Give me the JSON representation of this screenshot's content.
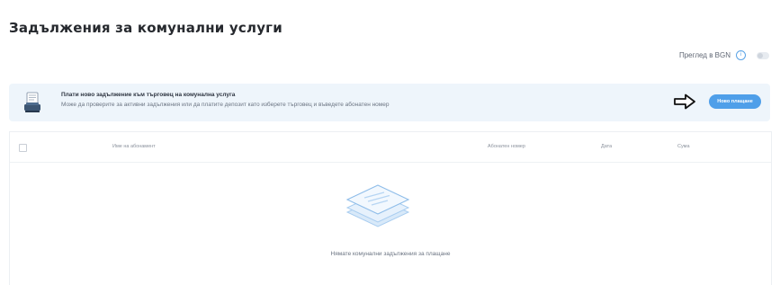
{
  "page": {
    "title": "Задължения за комунални услуги"
  },
  "currency_view": {
    "label": "Преглед в BGN",
    "info_icon": "info-icon"
  },
  "banner": {
    "icon": "document-stamp-icon",
    "title": "Плати ново задължение към търговец на комунална услуга",
    "text": "Може да проверите за активни задължения или да платите депозит като изберете търговец и въведете абонатен номер",
    "arrow_icon": "arrow-right-icon",
    "button_label": "Ново плащане"
  },
  "table": {
    "columns": [
      "Име на абонамент",
      "Абонатен номер",
      "Дата",
      "Сума"
    ],
    "empty_icon": "empty-stack-icon",
    "empty_message": "Нямате комунални задължения за плащане"
  },
  "colors": {
    "accent": "#4f9fe9",
    "banner_bg": "#eef5fb"
  }
}
